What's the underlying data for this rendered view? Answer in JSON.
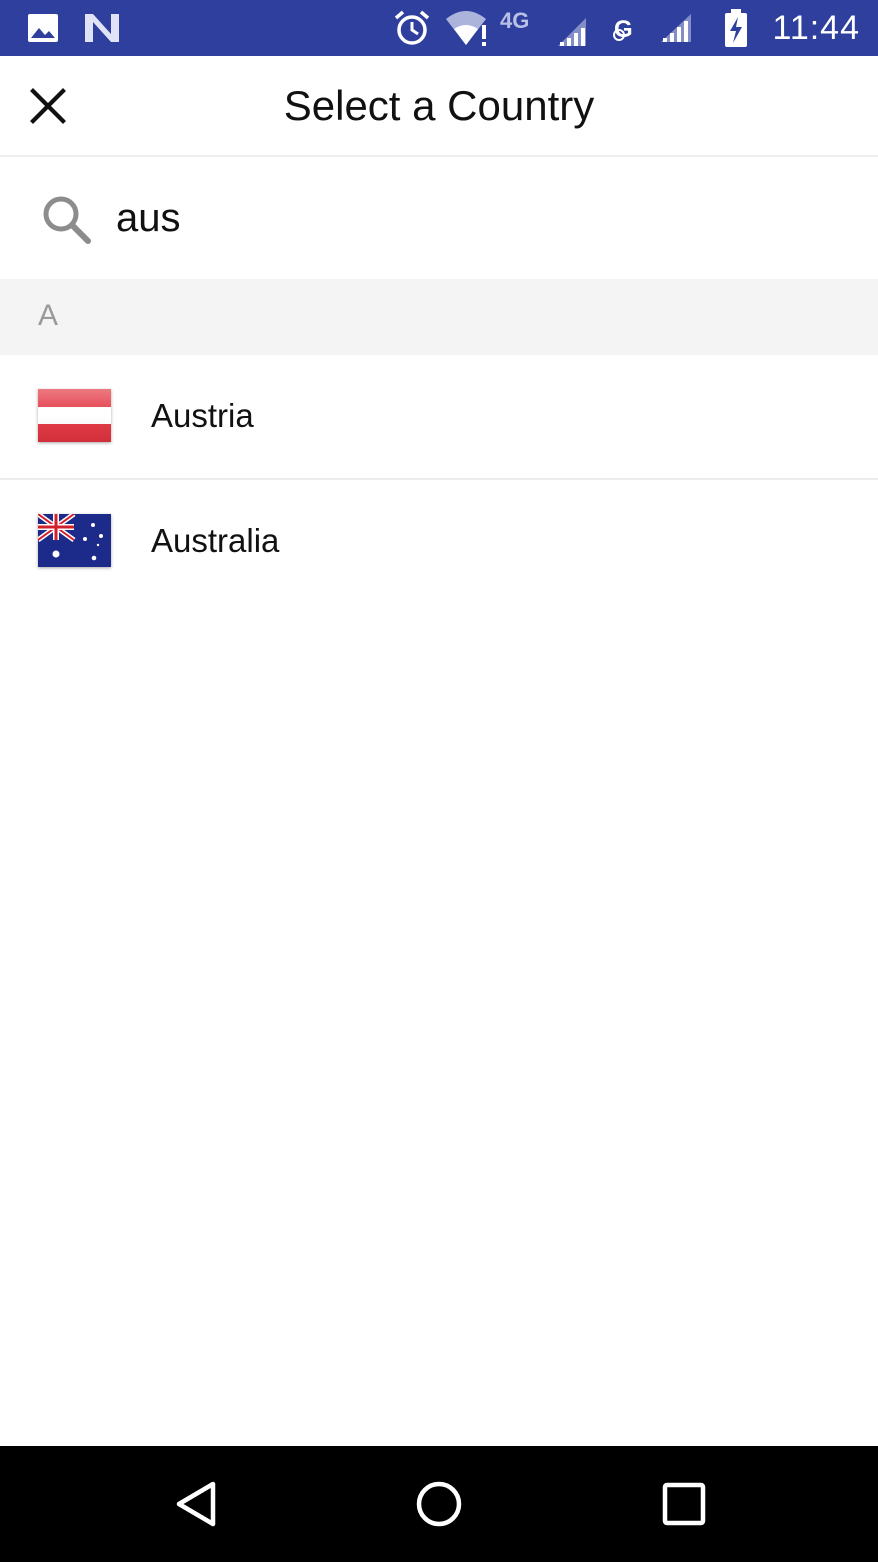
{
  "status_bar": {
    "time": "11:44",
    "network_label": "4G",
    "icons": [
      "gallery-icon",
      "n-app-icon",
      "alarm-icon",
      "wifi-alert-icon",
      "signal-4g-icon",
      "g-signal-icon",
      "signal-icon",
      "battery-charging-icon"
    ],
    "background": "#2f3f9e"
  },
  "app_bar": {
    "title": "Select a Country",
    "close_icon": "close-icon"
  },
  "search": {
    "value": "aus",
    "icon": "search-icon"
  },
  "section": {
    "letter": "A"
  },
  "countries": [
    {
      "name": "Austria",
      "flag": "austria-flag"
    },
    {
      "name": "Australia",
      "flag": "australia-flag"
    }
  ],
  "nav_bar": {
    "buttons": [
      "back-icon",
      "home-icon",
      "recents-icon"
    ]
  }
}
